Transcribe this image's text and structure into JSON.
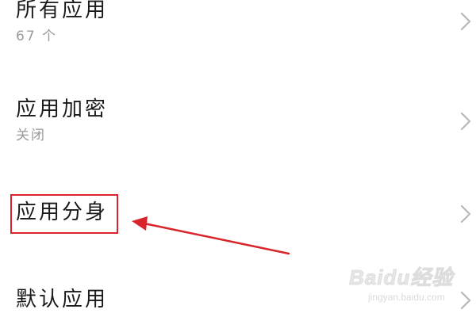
{
  "settings_list": {
    "items": [
      {
        "title": "所有应用",
        "subtitle": "67 个"
      },
      {
        "title": "应用加密",
        "subtitle": "关闭"
      },
      {
        "title": "应用分身",
        "subtitle": ""
      },
      {
        "title": "默认应用",
        "subtitle": ""
      }
    ]
  },
  "annotation": {
    "highlight_color": "#d8242a",
    "arrow_color": "#d8242a"
  },
  "watermark": {
    "logo_text": "Baidu经验",
    "url": "jingyan.baidu.com"
  },
  "icons": {
    "chevron": "chevron-right-icon"
  },
  "colors": {
    "title_text": "#1a1a1a",
    "subtitle_text": "#9a9a9a",
    "chevron": "#b8b8b8",
    "background": "#ffffff"
  }
}
